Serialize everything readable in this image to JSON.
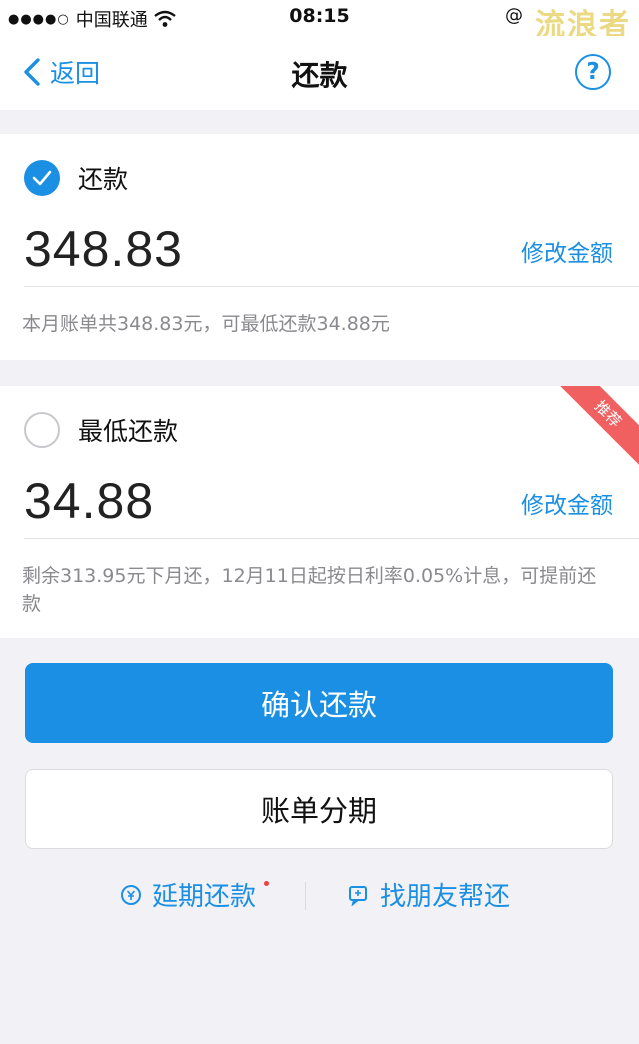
{
  "status_bar": {
    "signal": "●●●●○",
    "carrier": "中国联通",
    "wifi_icon": "wifi-icon",
    "time": "08:15",
    "right_text": "@ ",
    "watermark": "流浪者"
  },
  "nav": {
    "back_label": "返回",
    "title": "还款",
    "help_label": "?"
  },
  "full_payment": {
    "selected": true,
    "label": "还款",
    "amount": "348.83",
    "edit_label": "修改金额",
    "description": "本月账单共348.83元，可最低还款34.88元"
  },
  "min_payment": {
    "selected": false,
    "label": "最低还款",
    "amount": "34.88",
    "edit_label": "修改金额",
    "description": "剩余313.95元下月还，12月11日起按日利率0.05%计息，可提前还款",
    "badge": "推荐"
  },
  "actions": {
    "confirm_label": "确认还款",
    "installment_label": "账单分期"
  },
  "links": {
    "delay_label": "延期还款",
    "friend_label": "找朋友帮还"
  },
  "colors": {
    "accent": "#1a8fe3",
    "badge": "#f06060",
    "background": "#f2f2f6"
  }
}
